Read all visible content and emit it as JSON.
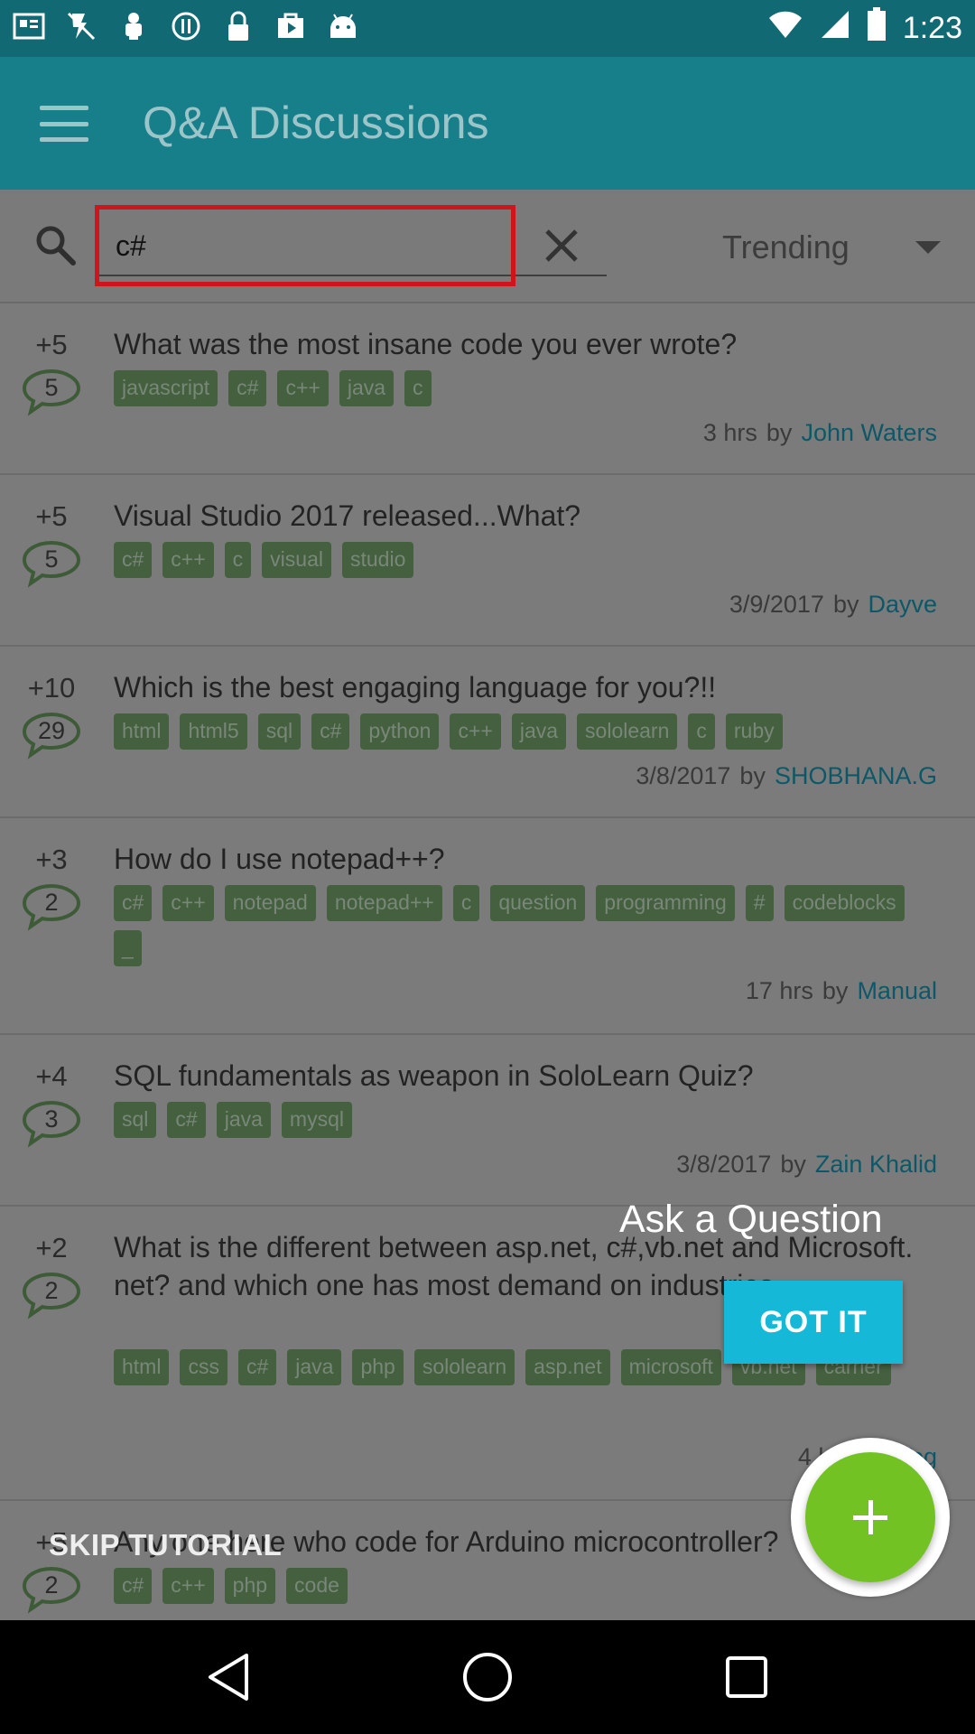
{
  "status_bar": {
    "time": "1:23",
    "icons": [
      "gallery-icon",
      "flashlight-off-icon",
      "download-icon",
      "sync-icon",
      "lock-icon",
      "play-store-icon",
      "android-icon"
    ]
  },
  "app_bar": {
    "title": "Q&A Discussions"
  },
  "search": {
    "value": "c#",
    "placeholder": ""
  },
  "sort": {
    "selected": "Trending"
  },
  "colors": {
    "app_bar": "#177f8a",
    "accent": "#15b8d6",
    "fab": "#73c224",
    "highlight": "#d0141c",
    "author": "#0d5868"
  },
  "posts": [
    {
      "votes": "+5",
      "answers": "5",
      "title": "What was the most insane code you ever wrote?",
      "tags": [
        "javascript",
        "c#",
        "c++",
        "java",
        "c"
      ],
      "time": "3 hrs",
      "by": "by",
      "author": "John Waters"
    },
    {
      "votes": "+5",
      "answers": "5",
      "title": "Visual Studio 2017 released...What?",
      "tags": [
        "c#",
        "c++",
        "c",
        "visual",
        "studio"
      ],
      "time": "3/9/2017",
      "by": "by",
      "author": "Dayve"
    },
    {
      "votes": "+10",
      "answers": "29",
      "title": "Which is the best engaging language for you?!!",
      "tags": [
        "html",
        "html5",
        "sql",
        "c#",
        "python",
        "c++",
        "java",
        "sololearn",
        "c",
        "ruby"
      ],
      "time": "3/8/2017",
      "by": "by",
      "author": "SHOBHANA.G"
    },
    {
      "votes": "+3",
      "answers": "2",
      "title": "How do I use notepad++?",
      "tags": [
        "c#",
        "c++",
        "notepad",
        "notepad++",
        "c",
        "question",
        "programming",
        "#",
        "codeblocks",
        "_"
      ],
      "time": "17 hrs",
      "by": "by",
      "author": "Manual"
    },
    {
      "votes": "+4",
      "answers": "3",
      "title": "SQL fundamentals as weapon in SoloLearn Quiz?",
      "tags": [
        "sql",
        "c#",
        "java",
        "mysql"
      ],
      "time": "3/8/2017",
      "by": "by",
      "author": "Zain Khalid"
    },
    {
      "votes": "+2",
      "answers": "2",
      "title": "What is the different between asp.net, c#,vb.net and Microsoft. net? and which one has most demand on industries.",
      "tags": [
        "html",
        "css",
        "c#",
        "java",
        "php",
        "sololearn",
        "asp.net",
        "microsoft",
        "vb.net",
        "carrier"
      ],
      "time": "4 hrs",
      "by": "by",
      "author": "Yog"
    },
    {
      "votes": "+5",
      "answers": "2",
      "title": "Any one here who code for Arduino microcontroller?",
      "tags": [
        "c#",
        "c++",
        "php",
        "code"
      ],
      "time": "",
      "by": "",
      "author": ""
    }
  ],
  "tutorial": {
    "title": "Ask a Question",
    "got_it": "GOT IT",
    "skip": "SKIP TUTORIAL"
  },
  "nav": {
    "icons": [
      "back-icon",
      "home-icon",
      "recents-icon"
    ]
  }
}
